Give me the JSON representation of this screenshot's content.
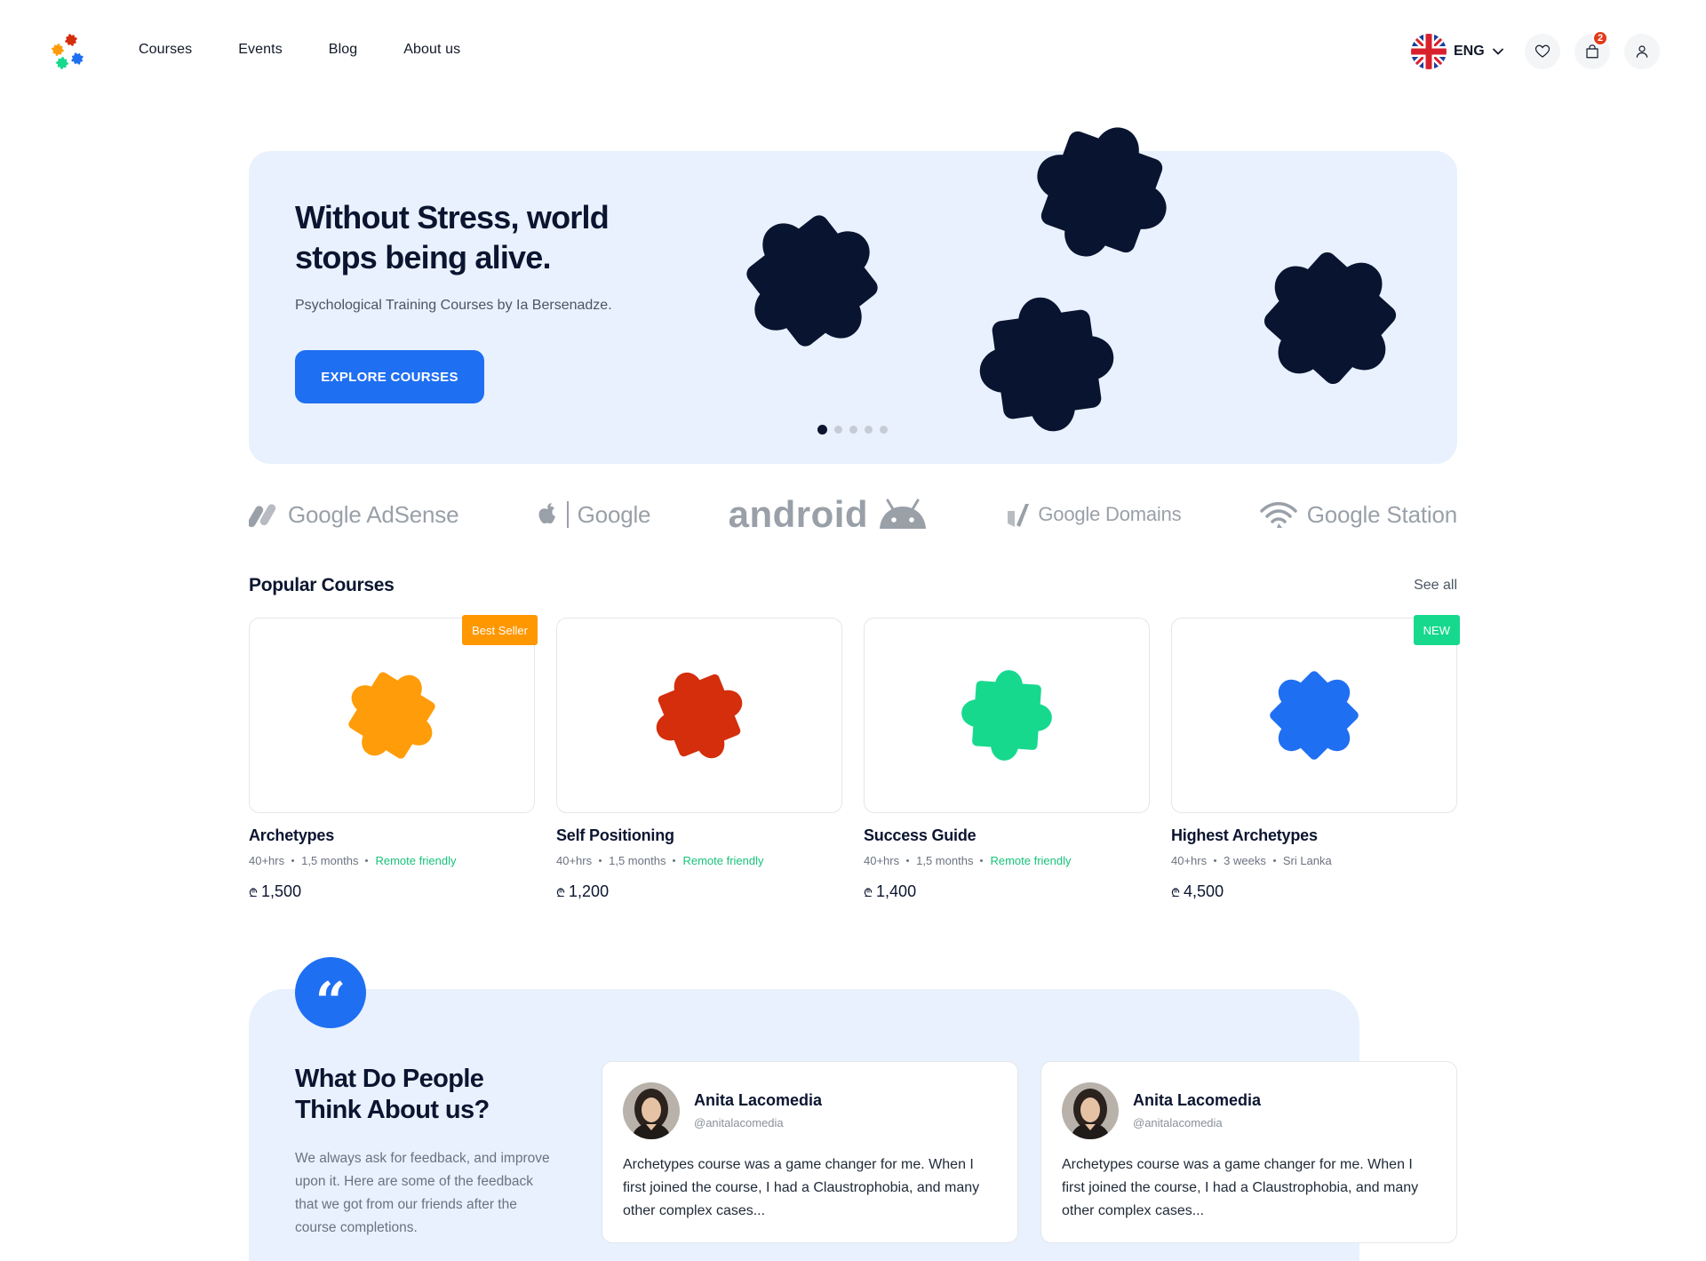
{
  "nav": {
    "links": [
      "Courses",
      "Events",
      "Blog",
      "About us"
    ],
    "language": "ENG",
    "cart_count": "2"
  },
  "hero": {
    "title": "Without Stress, world stops being alive.",
    "subtitle": "Psychological Training Courses by Ia Bersenadze.",
    "cta": "EXPLORE COURSES",
    "slides_total": 5,
    "active_slide": 1
  },
  "brands": [
    "Google AdSense",
    "Google",
    "android",
    "Google Domains",
    "Google Station"
  ],
  "popular": {
    "title": "Popular Courses",
    "see_all": "See all",
    "courses": [
      {
        "name": "Archetypes",
        "hours": "40+hrs",
        "duration": "1,5 months",
        "extra": "Remote friendly",
        "currency": "₾",
        "price": "1,500",
        "tag": "Best Seller",
        "tag_color": "#ff9700",
        "puzzle_color": "#ff9c0a"
      },
      {
        "name": "Self Positioning",
        "hours": "40+hrs",
        "duration": "1,5 months",
        "extra": "Remote friendly",
        "currency": "₾",
        "price": "1,200",
        "tag": "",
        "puzzle_color": "#d42e0c"
      },
      {
        "name": "Success Guide",
        "hours": "40+hrs",
        "duration": "1,5 months",
        "extra": "Remote friendly",
        "currency": "₾",
        "price": "1,400",
        "tag": "",
        "puzzle_color": "#17d98e"
      },
      {
        "name": "Highest Archetypes",
        "hours": "40+hrs",
        "duration": "3 weeks",
        "extra": "Sri Lanka",
        "currency": "₾",
        "price": "4,500",
        "tag": "NEW",
        "tag_color": "#17d98e",
        "puzzle_color": "#1f6ff2"
      }
    ]
  },
  "testimonials": {
    "quote_mark": "“",
    "title": "What Do People Think About us?",
    "subtitle": "We always ask for feedback, and improve upon it. Here are some of the feedback that we got from our friends after the course completions.",
    "reviews": [
      {
        "name": "Anita Lacomedia",
        "handle": "@anitalacomedia",
        "text": "Archetypes course was a game changer for me. When I first joined the course, I had a Claustrophobia, and many other complex cases..."
      },
      {
        "name": "Anita Lacomedia",
        "handle": "@anitalacomedia",
        "text": "Archetypes course was a game changer for me. When I first joined the course, I had a Claustrophobia, and many other complex cases..."
      }
    ]
  },
  "colors": {
    "primary": "#1f6ff2",
    "dark": "#0b1530",
    "hero_bg": "#e8f1fd",
    "green": "#18c27a"
  }
}
